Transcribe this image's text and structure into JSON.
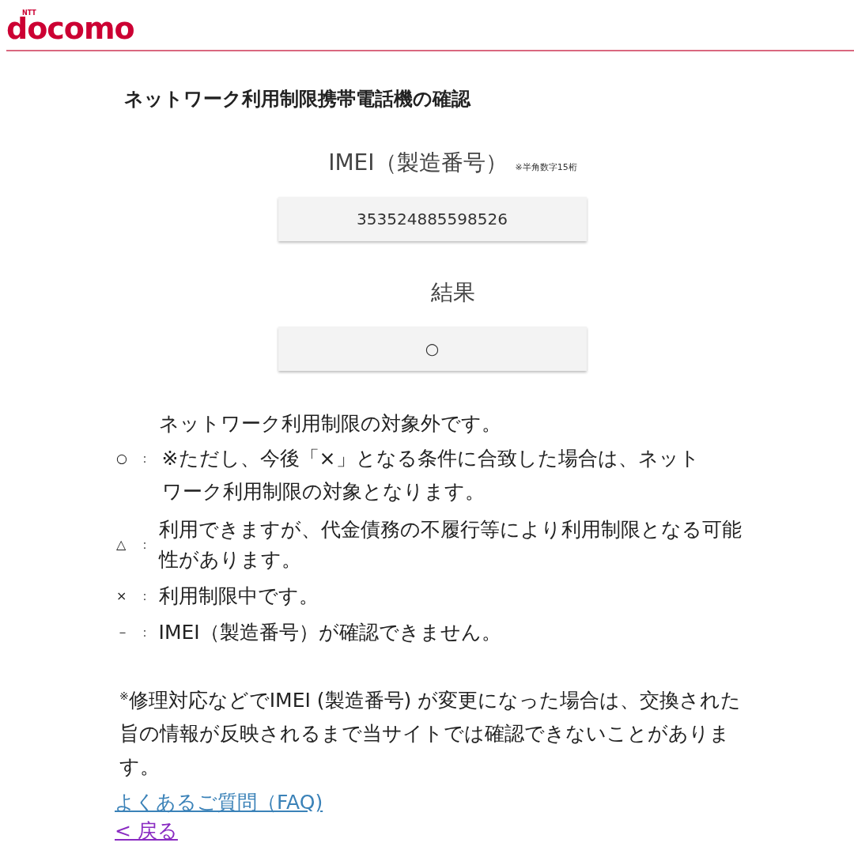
{
  "header": {
    "logo_small": "NTT",
    "logo": "docomo"
  },
  "title": "ネットワーク利用制限携帯電話機の確認",
  "imei": {
    "label": "IMEI（製造番号）",
    "hint": "※半角数字15桁",
    "value": "353524885598526"
  },
  "result": {
    "label": "結果",
    "value": "○"
  },
  "legend": [
    {
      "symbol": "○",
      "separator": "：",
      "text": "ネットワーク利用制限の対象外です。",
      "note": "※ただし、今後「×」となる条件に合致した場合は、ネットワーク利用制限の対象となります。"
    },
    {
      "symbol": "△",
      "separator": "：",
      "text": "利用できますが、代金債務の不履行等により利用制限となる可能性があります。"
    },
    {
      "symbol": "×",
      "separator": "：",
      "text": "利用制限中です。"
    },
    {
      "symbol": "－",
      "separator": "：",
      "text": "IMEI（製造番号）が確認できません。"
    }
  ],
  "notice": "$^{※}$修理対応などでIMEI (製造番号) が変更になった場合は、交換された旨の情報が反映されるまで当サイトでは確認できないことがあります。",
  "links": [
    {
      "label": "よくあるご質問（FAQ)",
      "visited": false
    },
    {
      "label": "< 戻る",
      "visited": true
    }
  ]
}
